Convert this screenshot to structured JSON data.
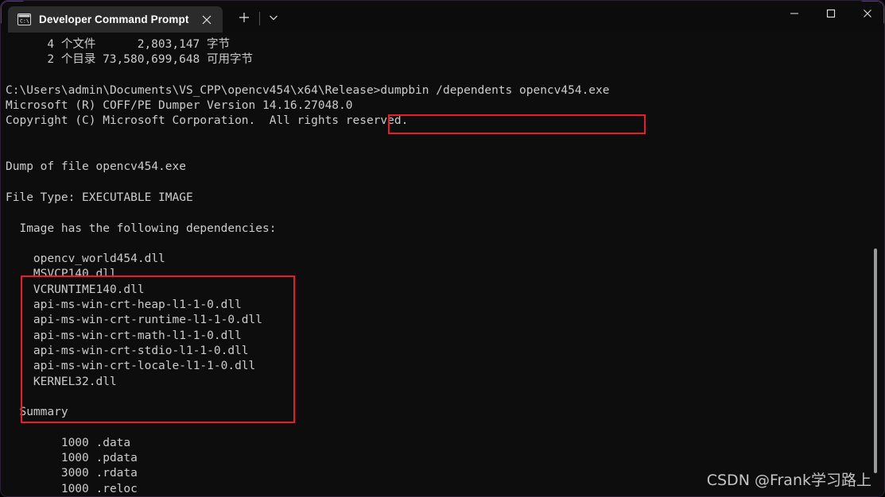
{
  "window": {
    "accent_color": "#965fd2",
    "titlebar_bg": "#0c0c0c",
    "terminal_bg": "#0d0d0d",
    "text_color": "#cccccc",
    "annotation_color": "#ed1c24"
  },
  "titlebar": {
    "tab": {
      "icon": "console-window-icon",
      "icon_label": "C:\\",
      "title": "Developer Command Prompt",
      "close_label": "✕"
    },
    "new_tab_label": "+",
    "dropdown_label": "⌄",
    "controls": {
      "minimize_label": "—",
      "maximize_label": "□",
      "close_label": "✕"
    }
  },
  "terminal": {
    "content": "      4 个文件      2,803,147 字节\n      2 个目录 73,580,699,648 可用字节\n\nC:\\Users\\admin\\Documents\\VS_CPP\\opencv454\\x64\\Release>dumpbin /dependents opencv454.exe\nMicrosoft (R) COFF/PE Dumper Version 14.16.27048.0\nCopyright (C) Microsoft Corporation.  All rights reserved.\n\n\nDump of file opencv454.exe\n\nFile Type: EXECUTABLE IMAGE\n\n  Image has the following dependencies:\n\n    opencv_world454.dll\n    MSVCP140.dll\n    VCRUNTIME140.dll\n    api-ms-win-crt-heap-l1-1-0.dll\n    api-ms-win-crt-runtime-l1-1-0.dll\n    api-ms-win-crt-math-l1-1-0.dll\n    api-ms-win-crt-stdio-l1-1-0.dll\n    api-ms-win-crt-locale-l1-1-0.dll\n    KERNEL32.dll\n\n  Summary\n\n        1000 .data\n        1000 .pdata\n        3000 .rdata\n        1000 .reloc",
    "lines": [
      "      4 个文件      2,803,147 字节",
      "      2 个目录 73,580,699,648 可用字节",
      "",
      "C:\\Users\\admin\\Documents\\VS_CPP\\opencv454\\x64\\Release>dumpbin /dependents opencv454.exe",
      "Microsoft (R) COFF/PE Dumper Version 14.16.27048.0",
      "Copyright (C) Microsoft Corporation.  All rights reserved.",
      "",
      "",
      "Dump of file opencv454.exe",
      "",
      "File Type: EXECUTABLE IMAGE",
      "",
      "  Image has the following dependencies:",
      "",
      "    opencv_world454.dll",
      "    MSVCP140.dll",
      "    VCRUNTIME140.dll",
      "    api-ms-win-crt-heap-l1-1-0.dll",
      "    api-ms-win-crt-runtime-l1-1-0.dll",
      "    api-ms-win-crt-math-l1-1-0.dll",
      "    api-ms-win-crt-stdio-l1-1-0.dll",
      "    api-ms-win-crt-locale-l1-1-0.dll",
      "    KERNEL32.dll",
      "",
      "  Summary",
      "",
      "        1000 .data",
      "        1000 .pdata",
      "        3000 .rdata",
      "        1000 .reloc"
    ],
    "prompt_path": "C:\\Users\\admin\\Documents\\VS_CPP\\opencv454\\x64\\Release",
    "command": "dumpbin /dependents opencv454.exe",
    "dependencies": [
      "opencv_world454.dll",
      "MSVCP140.dll",
      "VCRUNTIME140.dll",
      "api-ms-win-crt-heap-l1-1-0.dll",
      "api-ms-win-crt-runtime-l1-1-0.dll",
      "api-ms-win-crt-math-l1-1-0.dll",
      "api-ms-win-crt-stdio-l1-1-0.dll",
      "api-ms-win-crt-locale-l1-1-0.dll",
      "KERNEL32.dll"
    ],
    "summary": [
      {
        "size": "1000",
        "section": ".data"
      },
      {
        "size": "1000",
        "section": ".pdata"
      },
      {
        "size": "3000",
        "section": ".rdata"
      },
      {
        "size": "1000",
        "section": ".reloc"
      }
    ],
    "file_count": "4",
    "file_bytes": "2,803,147",
    "dir_count": "2",
    "free_bytes": "73,580,699,648"
  },
  "watermark": {
    "text": "CSDN @Frank学习路上"
  }
}
